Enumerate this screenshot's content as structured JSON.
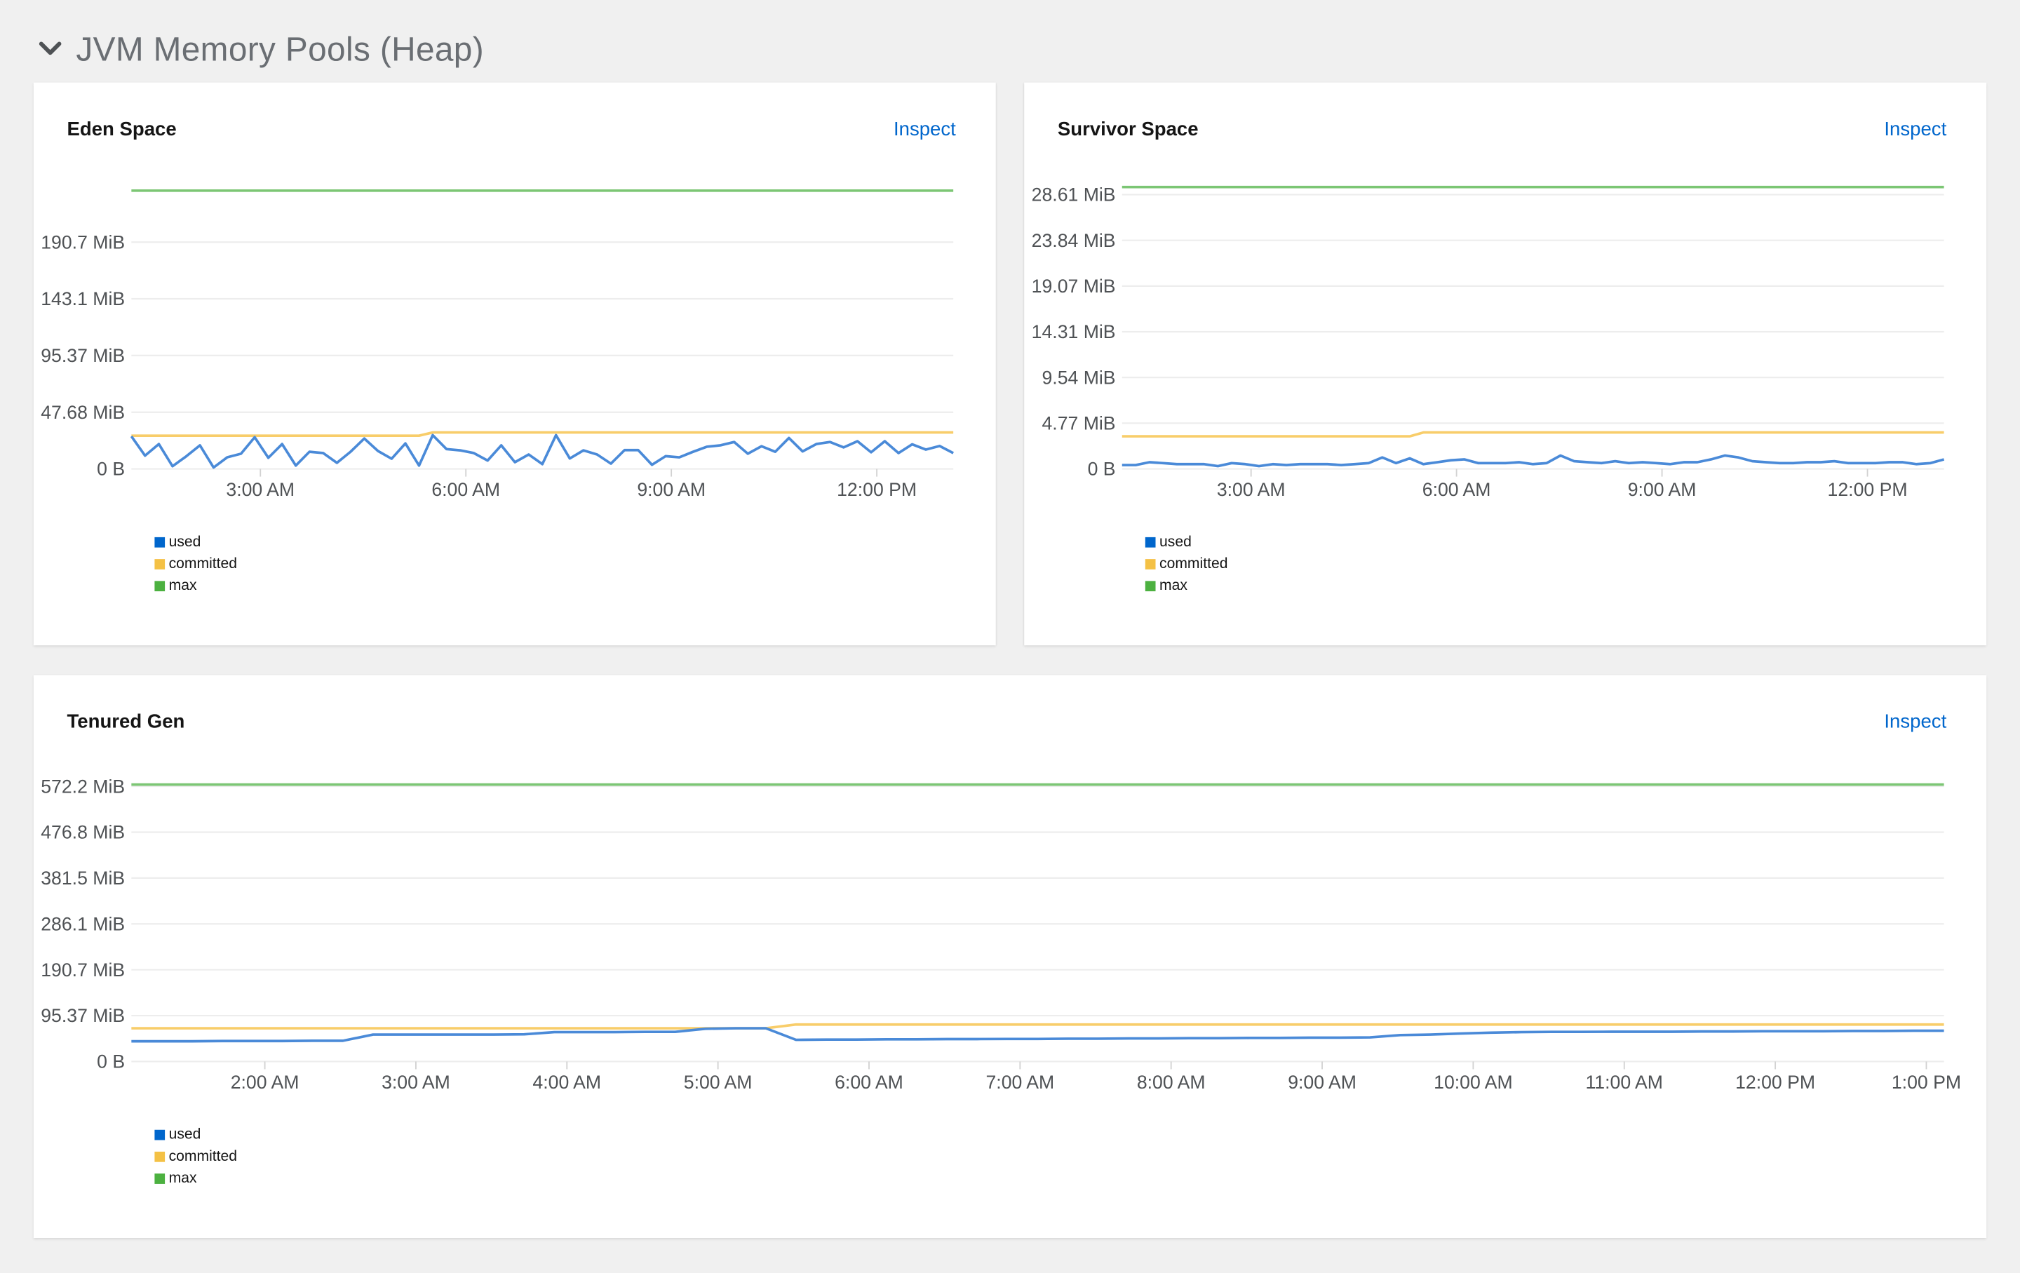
{
  "section": {
    "title": "JVM Memory Pools (Heap)",
    "icon": "chevron-down-icon"
  },
  "colors": {
    "used": "#4a8ad8",
    "used_legend": "#0066cc",
    "committed": "#f8cd6a",
    "committed_legend": "#f4c145",
    "max": "#7cc674",
    "max_legend": "#4cb140",
    "grid": "#ededed",
    "link": "#0066cc"
  },
  "cards": [
    {
      "title": "Eden Space",
      "inspect_label": "Inspect",
      "legend": [
        "used",
        "committed",
        "max"
      ]
    },
    {
      "title": "Survivor Space",
      "inspect_label": "Inspect",
      "legend": [
        "used",
        "committed",
        "max"
      ]
    },
    {
      "title": "Tenured Gen",
      "inspect_label": "Inspect",
      "legend": [
        "used",
        "committed",
        "max"
      ]
    }
  ],
  "chart_data": [
    {
      "type": "line",
      "title": "Eden Space",
      "unit": "MiB",
      "grid": true,
      "legend_placement": "bottom-left",
      "xlim": [
        "01:07",
        "13:07"
      ],
      "ylim": [
        0,
        242.7
      ],
      "y_ticks": [
        {
          "v": 0,
          "label": "0 B"
        },
        {
          "v": 47.68,
          "label": "47.68 MiB"
        },
        {
          "v": 95.37,
          "label": "95.37 MiB"
        },
        {
          "v": 143.1,
          "label": "143.1 MiB"
        },
        {
          "v": 190.7,
          "label": "190.7 MiB"
        }
      ],
      "x_ticks": [
        {
          "t": "03:00",
          "label": "3:00 AM"
        },
        {
          "t": "06:00",
          "label": "6:00 AM"
        },
        {
          "t": "09:00",
          "label": "9:00 AM"
        },
        {
          "t": "12:00",
          "label": "12:00 PM"
        }
      ],
      "x": [
        "01:07",
        "01:19",
        "01:31",
        "01:43",
        "01:55",
        "02:07",
        "02:19",
        "02:31",
        "02:43",
        "02:55",
        "03:07",
        "03:19",
        "03:31",
        "03:43",
        "03:55",
        "04:07",
        "04:19",
        "04:31",
        "04:43",
        "04:55",
        "05:07",
        "05:19",
        "05:31",
        "05:43",
        "05:55",
        "06:07",
        "06:19",
        "06:31",
        "06:43",
        "06:55",
        "07:07",
        "07:19",
        "07:31",
        "07:43",
        "07:55",
        "08:07",
        "08:19",
        "08:31",
        "08:43",
        "08:55",
        "09:07",
        "09:19",
        "09:31",
        "09:43",
        "09:55",
        "10:07",
        "10:19",
        "10:31",
        "10:43",
        "10:55",
        "11:07",
        "11:19",
        "11:31",
        "11:43",
        "11:55",
        "12:07",
        "12:19",
        "12:31",
        "12:43",
        "12:55",
        "13:07"
      ],
      "series": [
        {
          "name": "used",
          "values": [
            27.4,
            11.2,
            20.9,
            2.3,
            10.5,
            19.8,
            1.2,
            9.8,
            12.8,
            26.7,
            9.3,
            20.9,
            2.8,
            14.4,
            13.3,
            5.1,
            14.4,
            25.6,
            15.1,
            8.6,
            21.4,
            2.8,
            28.4,
            16.7,
            15.6,
            13.3,
            7.0,
            19.8,
            5.6,
            12.1,
            4.0,
            28.4,
            8.8,
            15.6,
            12.1,
            4.4,
            15.8,
            15.8,
            3.5,
            10.7,
            9.8,
            14.4,
            18.6,
            19.8,
            22.6,
            12.8,
            19.1,
            14.4,
            26.0,
            14.7,
            20.9,
            22.6,
            18.1,
            23.3,
            14.0,
            23.3,
            13.3,
            20.7,
            16.3,
            19.3,
            13.3
          ]
        },
        {
          "name": "committed",
          "values": [
            27.9,
            27.9,
            27.9,
            27.9,
            27.9,
            27.9,
            27.9,
            27.9,
            27.9,
            27.9,
            27.9,
            27.9,
            27.9,
            27.9,
            27.9,
            27.9,
            27.9,
            27.9,
            27.9,
            27.9,
            27.9,
            27.9,
            30.7,
            30.7,
            30.7,
            30.7,
            30.7,
            30.7,
            30.7,
            30.7,
            30.7,
            30.7,
            30.7,
            30.7,
            30.7,
            30.7,
            30.7,
            30.7,
            30.7,
            30.7,
            30.7,
            30.7,
            30.7,
            30.7,
            30.7,
            30.7,
            30.7,
            30.7,
            30.7,
            30.7,
            30.7,
            30.7,
            30.7,
            30.7,
            30.7,
            30.7,
            30.7,
            30.7,
            30.7,
            30.7,
            30.7
          ]
        },
        {
          "name": "max",
          "values": [
            234,
            234,
            234,
            234,
            234,
            234,
            234,
            234,
            234,
            234,
            234,
            234,
            234,
            234,
            234,
            234,
            234,
            234,
            234,
            234,
            234,
            234,
            234,
            234,
            234,
            234,
            234,
            234,
            234,
            234,
            234,
            234,
            234,
            234,
            234,
            234,
            234,
            234,
            234,
            234,
            234,
            234,
            234,
            234,
            234,
            234,
            234,
            234,
            234,
            234,
            234,
            234,
            234,
            234,
            234,
            234,
            234,
            234,
            234,
            234,
            234
          ]
        }
      ]
    },
    {
      "type": "line",
      "title": "Survivor Space",
      "unit": "MiB",
      "grid": true,
      "legend_placement": "bottom-left",
      "xlim": [
        "01:07",
        "13:07"
      ],
      "ylim": [
        0,
        30.1
      ],
      "y_ticks": [
        {
          "v": 0,
          "label": "0 B"
        },
        {
          "v": 4.77,
          "label": "4.77 MiB"
        },
        {
          "v": 9.54,
          "label": "9.54 MiB"
        },
        {
          "v": 14.31,
          "label": "14.31 MiB"
        },
        {
          "v": 19.07,
          "label": "19.07 MiB"
        },
        {
          "v": 23.84,
          "label": "23.84 MiB"
        },
        {
          "v": 28.61,
          "label": "28.61 MiB"
        }
      ],
      "x_ticks": [
        {
          "t": "03:00",
          "label": "3:00 AM"
        },
        {
          "t": "06:00",
          "label": "6:00 AM"
        },
        {
          "t": "09:00",
          "label": "9:00 AM"
        },
        {
          "t": "12:00",
          "label": "12:00 PM"
        }
      ],
      "x": [
        "01:07",
        "01:19",
        "01:31",
        "01:43",
        "01:55",
        "02:07",
        "02:19",
        "02:31",
        "02:43",
        "02:55",
        "03:07",
        "03:19",
        "03:31",
        "03:43",
        "03:55",
        "04:07",
        "04:19",
        "04:31",
        "04:43",
        "04:55",
        "05:07",
        "05:19",
        "05:31",
        "05:43",
        "05:55",
        "06:07",
        "06:19",
        "06:31",
        "06:43",
        "06:55",
        "07:07",
        "07:19",
        "07:31",
        "07:43",
        "07:55",
        "08:07",
        "08:19",
        "08:31",
        "08:43",
        "08:55",
        "09:07",
        "09:19",
        "09:31",
        "09:43",
        "09:55",
        "10:07",
        "10:19",
        "10:31",
        "10:43",
        "10:55",
        "11:07",
        "11:19",
        "11:31",
        "11:43",
        "11:55",
        "12:07",
        "12:19",
        "12:31",
        "12:43",
        "12:55",
        "13:07"
      ],
      "series": [
        {
          "name": "used",
          "values": [
            0.4,
            0.4,
            0.7,
            0.6,
            0.5,
            0.5,
            0.5,
            0.3,
            0.6,
            0.5,
            0.3,
            0.5,
            0.4,
            0.5,
            0.5,
            0.5,
            0.4,
            0.5,
            0.6,
            1.2,
            0.6,
            1.1,
            0.5,
            0.7,
            0.9,
            1.0,
            0.6,
            0.6,
            0.6,
            0.7,
            0.5,
            0.6,
            1.4,
            0.8,
            0.7,
            0.6,
            0.8,
            0.6,
            0.7,
            0.6,
            0.5,
            0.7,
            0.7,
            1.0,
            1.4,
            1.2,
            0.8,
            0.7,
            0.6,
            0.6,
            0.7,
            0.7,
            0.8,
            0.6,
            0.6,
            0.6,
            0.7,
            0.7,
            0.5,
            0.6,
            1.0
          ]
        },
        {
          "name": "committed",
          "values": [
            3.4,
            3.4,
            3.4,
            3.4,
            3.4,
            3.4,
            3.4,
            3.4,
            3.4,
            3.4,
            3.4,
            3.4,
            3.4,
            3.4,
            3.4,
            3.4,
            3.4,
            3.4,
            3.4,
            3.4,
            3.4,
            3.4,
            3.8,
            3.8,
            3.8,
            3.8,
            3.8,
            3.8,
            3.8,
            3.8,
            3.8,
            3.8,
            3.8,
            3.8,
            3.8,
            3.8,
            3.8,
            3.8,
            3.8,
            3.8,
            3.8,
            3.8,
            3.8,
            3.8,
            3.8,
            3.8,
            3.8,
            3.8,
            3.8,
            3.8,
            3.8,
            3.8,
            3.8,
            3.8,
            3.8,
            3.8,
            3.8,
            3.8,
            3.8,
            3.8,
            3.8
          ]
        },
        {
          "name": "max",
          "values": [
            29.4,
            29.4,
            29.4,
            29.4,
            29.4,
            29.4,
            29.4,
            29.4,
            29.4,
            29.4,
            29.4,
            29.4,
            29.4,
            29.4,
            29.4,
            29.4,
            29.4,
            29.4,
            29.4,
            29.4,
            29.4,
            29.4,
            29.4,
            29.4,
            29.4,
            29.4,
            29.4,
            29.4,
            29.4,
            29.4,
            29.4,
            29.4,
            29.4,
            29.4,
            29.4,
            29.4,
            29.4,
            29.4,
            29.4,
            29.4,
            29.4,
            29.4,
            29.4,
            29.4,
            29.4,
            29.4,
            29.4,
            29.4,
            29.4,
            29.4,
            29.4,
            29.4,
            29.4,
            29.4,
            29.4,
            29.4,
            29.4,
            29.4,
            29.4,
            29.4,
            29.4
          ]
        }
      ]
    },
    {
      "type": "line",
      "title": "Tenured Gen",
      "unit": "MiB",
      "grid": true,
      "legend_placement": "bottom-left",
      "xlim": [
        "01:07",
        "13:07"
      ],
      "ylim": [
        0,
        600
      ],
      "y_ticks": [
        {
          "v": 0,
          "label": "0 B"
        },
        {
          "v": 95.37,
          "label": "95.37 MiB"
        },
        {
          "v": 190.7,
          "label": "190.7 MiB"
        },
        {
          "v": 286.1,
          "label": "286.1 MiB"
        },
        {
          "v": 381.5,
          "label": "381.5 MiB"
        },
        {
          "v": 476.8,
          "label": "476.8 MiB"
        },
        {
          "v": 572.2,
          "label": "572.2 MiB"
        }
      ],
      "x_ticks": [
        {
          "t": "02:00",
          "label": "2:00 AM"
        },
        {
          "t": "03:00",
          "label": "3:00 AM"
        },
        {
          "t": "04:00",
          "label": "4:00 AM"
        },
        {
          "t": "05:00",
          "label": "5:00 AM"
        },
        {
          "t": "06:00",
          "label": "6:00 AM"
        },
        {
          "t": "07:00",
          "label": "7:00 AM"
        },
        {
          "t": "08:00",
          "label": "8:00 AM"
        },
        {
          "t": "09:00",
          "label": "9:00 AM"
        },
        {
          "t": "10:00",
          "label": "10:00 AM"
        },
        {
          "t": "11:00",
          "label": "11:00 AM"
        },
        {
          "t": "12:00",
          "label": "12:00 PM"
        },
        {
          "t": "13:00",
          "label": "1:00 PM"
        }
      ],
      "x": [
        "01:07",
        "01:19",
        "01:31",
        "01:43",
        "01:55",
        "02:07",
        "02:19",
        "02:31",
        "02:43",
        "02:55",
        "03:07",
        "03:19",
        "03:31",
        "03:43",
        "03:55",
        "04:07",
        "04:19",
        "04:31",
        "04:43",
        "04:55",
        "05:07",
        "05:19",
        "05:31",
        "05:43",
        "05:55",
        "06:07",
        "06:19",
        "06:31",
        "06:43",
        "06:55",
        "07:07",
        "07:19",
        "07:31",
        "07:43",
        "07:55",
        "08:07",
        "08:19",
        "08:31",
        "08:43",
        "08:55",
        "09:07",
        "09:19",
        "09:31",
        "09:43",
        "09:55",
        "10:07",
        "10:19",
        "10:31",
        "10:43",
        "10:55",
        "11:07",
        "11:19",
        "11:31",
        "11:43",
        "11:55",
        "12:07",
        "12:19",
        "12:31",
        "12:43",
        "12:55",
        "13:07"
      ],
      "series": [
        {
          "name": "used",
          "values": [
            42,
            42,
            42,
            42.5,
            42.5,
            42.5,
            43,
            43,
            56,
            56,
            56,
            56,
            56,
            56.5,
            61,
            61,
            61,
            61.5,
            61.5,
            68,
            69,
            69,
            45,
            45.5,
            45.5,
            46,
            46,
            46.5,
            46.5,
            47,
            47,
            47.5,
            47.5,
            48,
            48,
            48.5,
            48.5,
            49,
            49,
            49.5,
            49.5,
            50,
            55,
            56,
            58,
            60,
            61,
            61.5,
            61.5,
            62,
            62,
            62,
            62.5,
            62.5,
            63,
            63,
            63,
            63.5,
            63.5,
            64,
            64
          ]
        },
        {
          "name": "committed",
          "values": [
            69,
            69,
            69,
            69,
            69,
            69,
            69,
            69,
            69,
            69,
            69,
            69,
            69,
            69,
            69,
            69,
            69,
            69,
            69,
            69,
            69,
            69,
            77,
            77,
            77,
            77,
            77,
            77,
            77,
            77,
            77,
            77,
            77,
            77,
            77,
            77,
            77,
            77,
            77,
            77,
            77,
            77,
            77,
            77,
            77,
            77,
            77,
            77,
            77,
            77,
            77,
            77,
            77,
            77,
            77,
            77,
            77,
            77,
            77,
            77,
            77
          ]
        },
        {
          "name": "max",
          "values": [
            576,
            576,
            576,
            576,
            576,
            576,
            576,
            576,
            576,
            576,
            576,
            576,
            576,
            576,
            576,
            576,
            576,
            576,
            576,
            576,
            576,
            576,
            576,
            576,
            576,
            576,
            576,
            576,
            576,
            576,
            576,
            576,
            576,
            576,
            576,
            576,
            576,
            576,
            576,
            576,
            576,
            576,
            576,
            576,
            576,
            576,
            576,
            576,
            576,
            576,
            576,
            576,
            576,
            576,
            576,
            576,
            576,
            576,
            576,
            576,
            576
          ]
        }
      ]
    }
  ]
}
